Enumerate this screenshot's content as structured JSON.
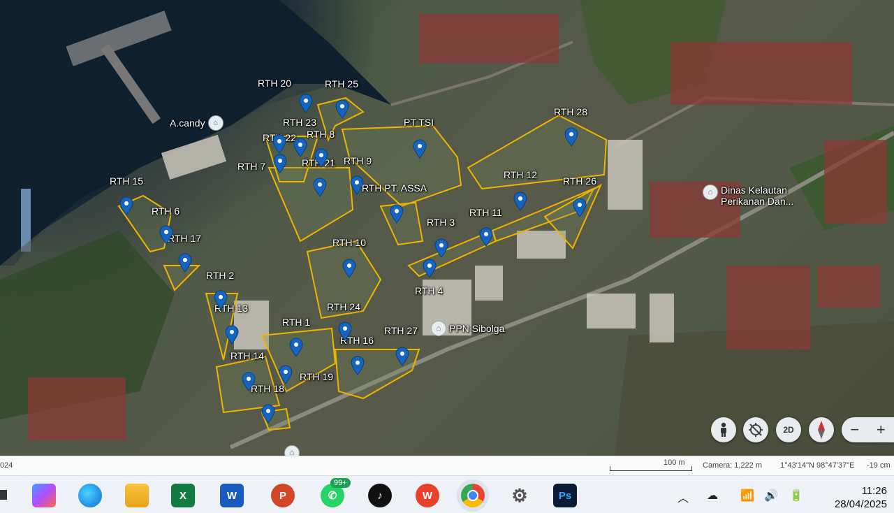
{
  "map": {
    "areas": [
      {
        "label": "RTH 20"
      },
      {
        "label": "RTH 25"
      },
      {
        "label": "RTH 23"
      },
      {
        "label": "RTH 22"
      },
      {
        "label": "RTH 8"
      },
      {
        "label": "RTH 9"
      },
      {
        "label": "RTH 7"
      },
      {
        "label": "RTH 21"
      },
      {
        "label": "PT TSI"
      },
      {
        "label": "RTH 28"
      },
      {
        "label": "RTH 12"
      },
      {
        "label": "RTH 26"
      },
      {
        "label": "RTH 15"
      },
      {
        "label": "RTH PT. ASSA"
      },
      {
        "label": "RTH 6"
      },
      {
        "label": "RTH 11"
      },
      {
        "label": "RTH 3"
      },
      {
        "label": "RTH 17"
      },
      {
        "label": "RTH 10"
      },
      {
        "label": "RTH 2"
      },
      {
        "label": "RTH 4"
      },
      {
        "label": "RTH 13"
      },
      {
        "label": "RTH 24"
      },
      {
        "label": "RTH 1"
      },
      {
        "label": "RTH 27"
      },
      {
        "label": "RTH 16"
      },
      {
        "label": "RTH 14"
      },
      {
        "label": "RTH 19"
      },
      {
        "label": "RTH 18"
      }
    ],
    "places": [
      {
        "name": "A.candy"
      },
      {
        "name": "Dinas Kelautan Perikanan Dan..."
      },
      {
        "name": "PPN Sibolga"
      }
    ],
    "pin_color": "#1565c0",
    "boundary_color": "#f0b400"
  },
  "controls": {
    "street_view": "pegman-icon",
    "north_reset": "compass-off-icon",
    "view_mode": "2D",
    "compass": "compass-icon",
    "zoom_out": "−",
    "zoom_in": "+"
  },
  "status": {
    "attribution": "024",
    "scale": "100 m",
    "camera": "Camera: 1,222 m",
    "coords": "1°43'14\"N 98°47'37\"E",
    "elevation": "-19 cm"
  },
  "taskbar": {
    "apps": [
      "Copilot",
      "Edge",
      "File Explorer",
      "Excel",
      "Word",
      "PowerPoint",
      "WhatsApp",
      "TikTok",
      "WPS Office",
      "Chrome",
      "Settings",
      "Photoshop"
    ],
    "whatsapp_badge": "99+",
    "time": "11:26",
    "date": "28/04/2025"
  }
}
